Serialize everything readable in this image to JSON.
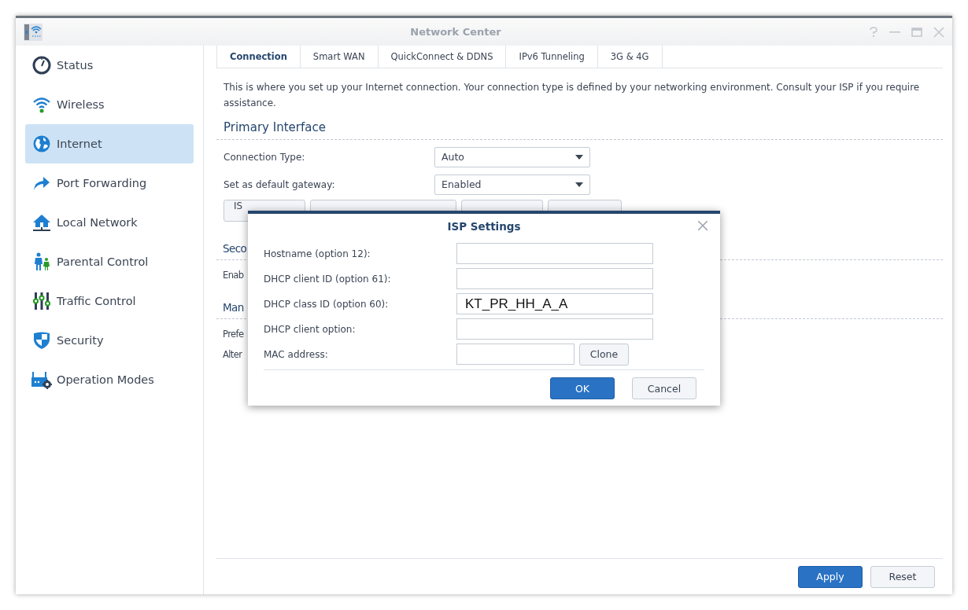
{
  "window": {
    "title": "Network Center"
  },
  "sidebar": {
    "items": [
      {
        "label": "Status",
        "selected": false
      },
      {
        "label": "Wireless",
        "selected": false
      },
      {
        "label": "Internet",
        "selected": true
      },
      {
        "label": "Port Forwarding",
        "selected": false
      },
      {
        "label": "Local Network",
        "selected": false
      },
      {
        "label": "Parental Control",
        "selected": false
      },
      {
        "label": "Traffic Control",
        "selected": false
      },
      {
        "label": "Security",
        "selected": false
      },
      {
        "label": "Operation Modes",
        "selected": false
      }
    ]
  },
  "tabs": [
    {
      "label": "Connection",
      "selected": true
    },
    {
      "label": "Smart WAN",
      "selected": false
    },
    {
      "label": "QuickConnect & DDNS",
      "selected": false
    },
    {
      "label": "IPv6 Tunneling",
      "selected": false
    },
    {
      "label": "3G & 4G",
      "selected": false
    }
  ],
  "intro": "This is where you set up your Internet connection. Your connection type is defined by your networking environment. Consult your ISP if you require assistance.",
  "primary_interface": {
    "title": "Primary Interface",
    "fields": [
      {
        "label": "Connection Type:",
        "value": "Auto"
      },
      {
        "label": "Set as default gateway:",
        "value": "Enabled"
      }
    ]
  },
  "section_buttons": [
    {
      "kind": "partial",
      "label": "IS"
    },
    {
      "kind": "covered"
    },
    {
      "kind": "covered"
    },
    {
      "kind": "covered"
    }
  ],
  "covered_texts": [
    {
      "kind": "heading",
      "text": "Seco"
    },
    {
      "kind": "label",
      "text": "Enab"
    },
    {
      "kind": "heading",
      "text": "Man"
    },
    {
      "kind": "label",
      "text": "Prefe"
    },
    {
      "kind": "label",
      "text": "Alter"
    }
  ],
  "dialog": {
    "title": "ISP Settings",
    "fields": [
      {
        "kind": "text",
        "label": "Hostname (option 12):"
      },
      {
        "kind": "text",
        "label": "DHCP client ID (option 61):"
      },
      {
        "kind": "text",
        "label": "DHCP class ID (option 60):",
        "value": "KT_PR_HH_A_A"
      },
      {
        "kind": "text",
        "label": "DHCP client option:"
      },
      {
        "kind": "text_with_button",
        "label": "MAC address:",
        "button": "Clone"
      }
    ],
    "buttons": [
      {
        "label": "OK",
        "primary": true
      },
      {
        "label": "Cancel",
        "primary": false
      }
    ]
  },
  "footer": {
    "buttons": [
      {
        "label": "Apply",
        "primary": true
      },
      {
        "label": "Reset",
        "primary": false
      }
    ]
  }
}
